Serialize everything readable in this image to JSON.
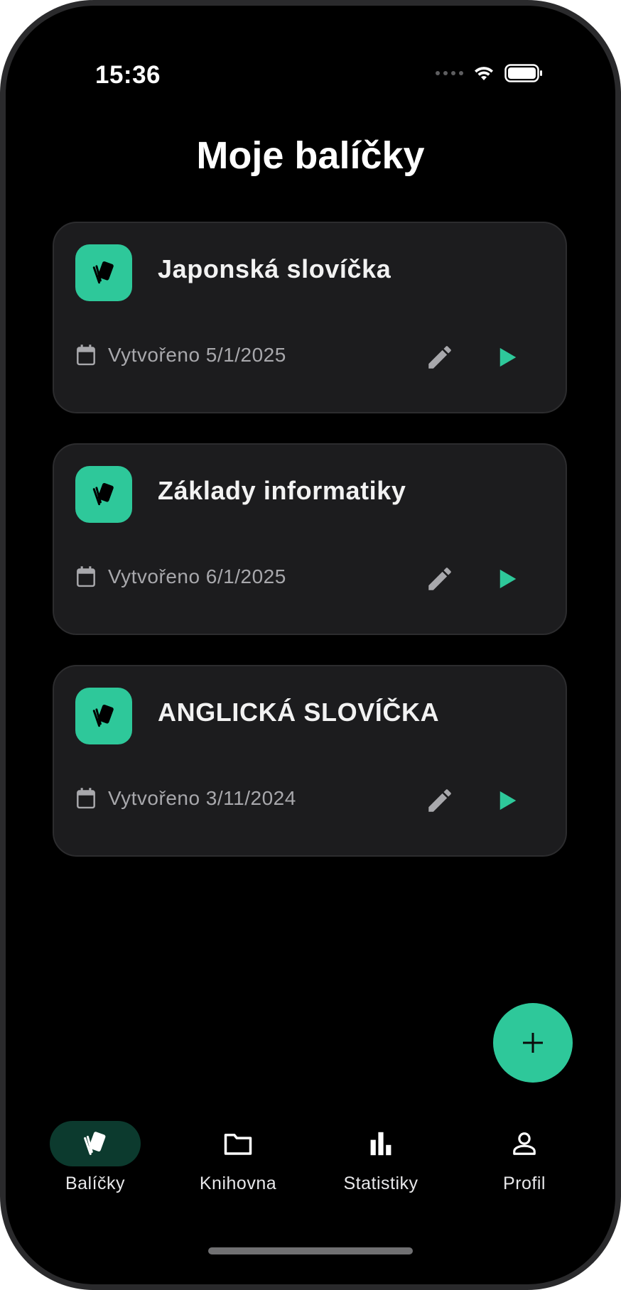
{
  "status_bar": {
    "time": "15:36",
    "signal_icon": "signal-dots-icon",
    "wifi_icon": "wifi-icon",
    "battery_icon": "battery-icon"
  },
  "header": {
    "title": "Moje balíčky"
  },
  "decks": [
    {
      "name": "Japonská slovíčka",
      "created": "Vytvořeno 5/1/2025"
    },
    {
      "name": "Základy informatiky",
      "created": "Vytvořeno 6/1/2025"
    },
    {
      "name": "ANGLICKÁ SLOVÍČKA",
      "created": "Vytvořeno 3/11/2024"
    }
  ],
  "fab": {
    "icon": "plus-icon"
  },
  "bottom_nav": {
    "items": [
      {
        "label": "Balíčky",
        "icon": "cards-icon",
        "active": true
      },
      {
        "label": "Knihovna",
        "icon": "folder-icon",
        "active": false
      },
      {
        "label": "Statistiky",
        "icon": "bar-chart-icon",
        "active": false
      },
      {
        "label": "Profil",
        "icon": "person-icon",
        "active": false
      }
    ]
  },
  "colors": {
    "accent": "#2ec89a",
    "card_background": "#1c1c1e",
    "screen_background": "#000000",
    "muted_text": "#a8a8ac"
  }
}
